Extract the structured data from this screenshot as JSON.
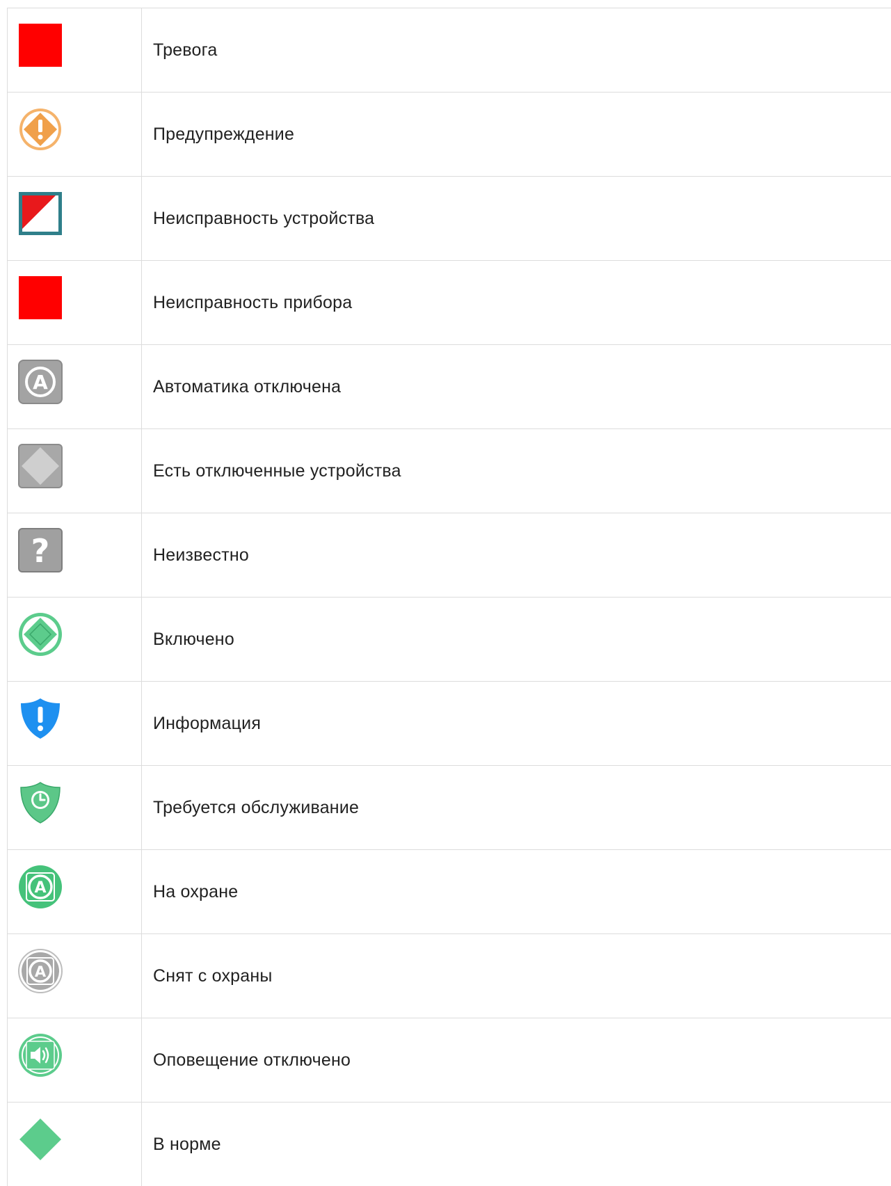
{
  "rows": [
    {
      "label": "Тревога",
      "icon": "red-square-icon",
      "color": "#ff0000"
    },
    {
      "label": "Предупреждение",
      "icon": "orange-warning-diamond-icon",
      "color": "#f0a04a"
    },
    {
      "label": "Неисправность устройства",
      "icon": "device-fault-icon",
      "color": "#e8191c"
    },
    {
      "label": "Неисправность прибора",
      "icon": "red-square-icon",
      "color": "#ff0000"
    },
    {
      "label": "Автоматика отключена",
      "icon": "automation-off-icon",
      "color": "#a3a3a3"
    },
    {
      "label": "Есть отключенные устройства",
      "icon": "disabled-devices-diamond-icon",
      "color": "#a8a8a8"
    },
    {
      "label": "Неизвестно",
      "icon": "unknown-question-icon",
      "color": "#a0a0a0"
    },
    {
      "label": "Включено",
      "icon": "enabled-green-diamond-icon",
      "color": "#5ccc8c"
    },
    {
      "label": "Информация",
      "icon": "info-shield-icon",
      "color": "#1e90f0"
    },
    {
      "label": "Требуется обслуживание",
      "icon": "maintenance-clock-shield-icon",
      "color": "#5cc788"
    },
    {
      "label": "На охране",
      "icon": "armed-green-icon",
      "color": "#45c27a"
    },
    {
      "label": "Снят с охраны",
      "icon": "disarmed-grey-icon",
      "color": "#a8a8a8"
    },
    {
      "label": "Оповещение отключено",
      "icon": "alert-disabled-speaker-icon",
      "color": "#5ccc8c"
    },
    {
      "label": "В норме",
      "icon": "normal-green-diamond-icon",
      "color": "#5ccc8c"
    }
  ]
}
